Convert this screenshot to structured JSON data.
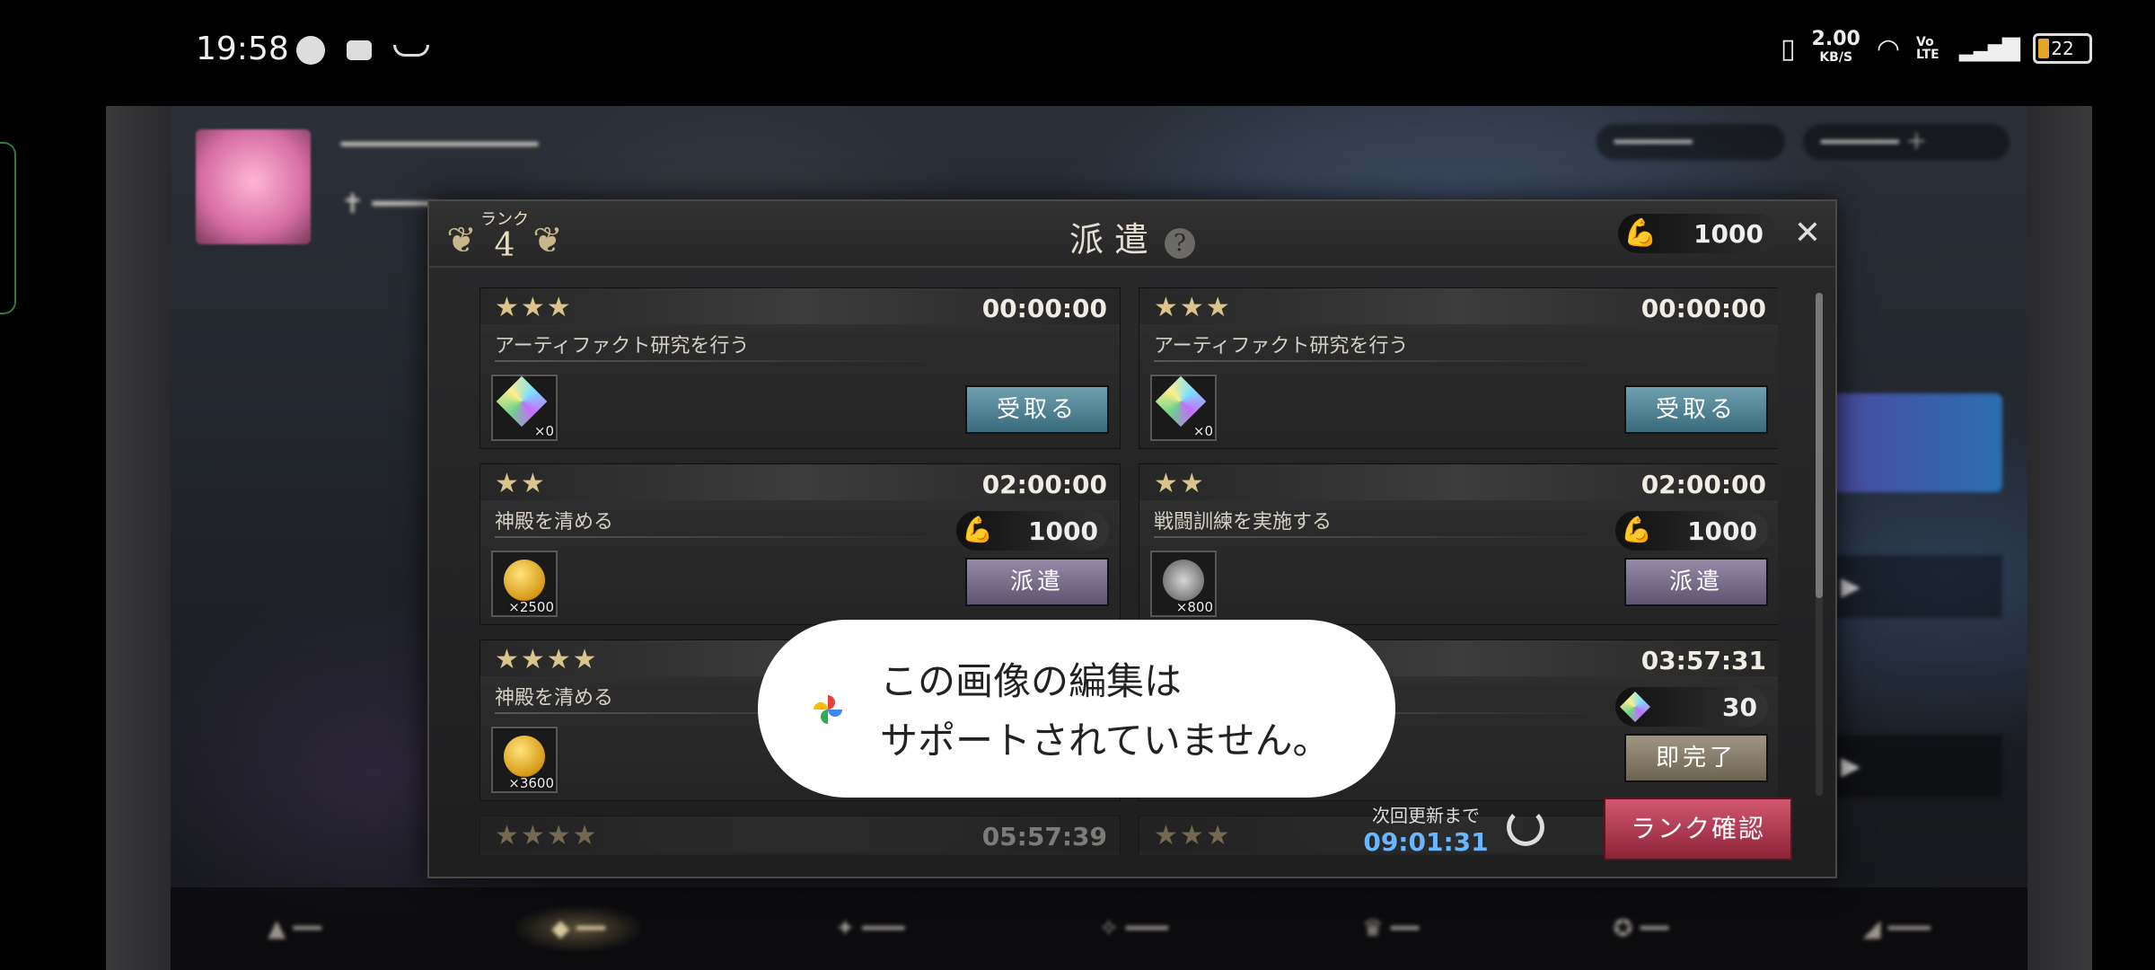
{
  "status_bar": {
    "time": "19:58",
    "speed_value": "2.00",
    "speed_unit": "KB/S",
    "network": "Vo LTE",
    "battery": "22",
    "icons": [
      "baseball-icon",
      "nfc-icon",
      "amazon-icon",
      "vibrate-icon",
      "wifi-icon",
      "signal-icon",
      "battery-icon"
    ]
  },
  "dialog": {
    "rank_label": "ランク",
    "rank_value": "4",
    "title": "派遣",
    "stamina": "1000",
    "missions": [
      {
        "stars": "★★★",
        "time": "00:00:00",
        "name": "アーティファクト研究を行う",
        "reward_qty": "×0",
        "reward_icon": "gem",
        "button": "受取る"
      },
      {
        "stars": "★★★",
        "time": "00:00:00",
        "name": "アーティファクト研究を行う",
        "reward_qty": "×0",
        "reward_icon": "gem",
        "button": "受取る"
      },
      {
        "stars": "★★",
        "time": "02:00:00",
        "name": "神殿を清める",
        "cost": "1000",
        "reward_qty": "×2500",
        "reward_icon": "coin",
        "button": "派遣"
      },
      {
        "stars": "★★",
        "time": "02:00:00",
        "name": "戦闘訓練を実施する",
        "cost": "1000",
        "reward_qty": "×800",
        "reward_icon": "medal",
        "button": "派遣"
      },
      {
        "stars": "★★★★",
        "time": "",
        "name": "神殿を清める",
        "reward_qty": "×3600",
        "reward_icon": "coin",
        "button": ""
      },
      {
        "stars": "",
        "time": "03:57:31",
        "name": "",
        "cost": "30",
        "button": "即完了"
      },
      {
        "stars": "★★★★",
        "time": "05:57:39"
      },
      {
        "stars": "★★★",
        "time": ""
      }
    ],
    "refresh_label": "次回更新まで",
    "refresh_time": "09:01:31",
    "rank_button": "ランク確認"
  },
  "toast": {
    "line1": "この画像の編集は",
    "line2": "サポートされていません。"
  }
}
